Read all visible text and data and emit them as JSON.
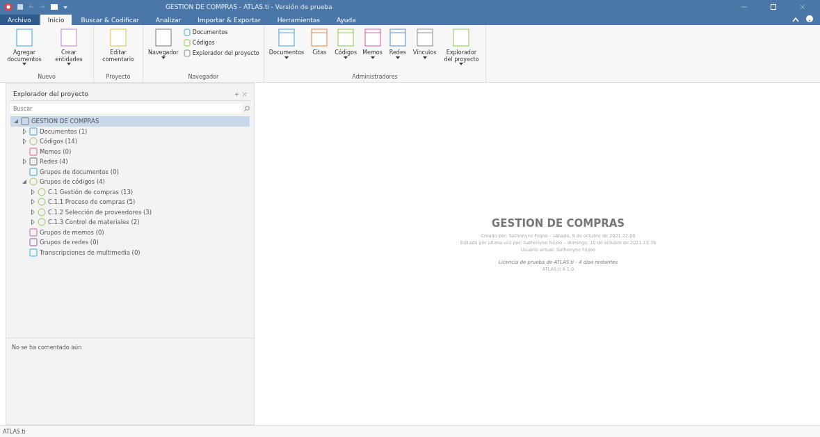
{
  "window": {
    "title": "GESTION DE COMPRAS - ATLAS.ti - Versión de prueba"
  },
  "tabs": [
    {
      "label": "Archivo",
      "selected": false,
      "kind": "file"
    },
    {
      "label": "Inicio",
      "selected": true,
      "kind": "tab"
    },
    {
      "label": "Buscar & Codificar",
      "selected": false,
      "kind": "tab"
    },
    {
      "label": "Analizar",
      "selected": false,
      "kind": "tab"
    },
    {
      "label": "Importar & Exportar",
      "selected": false,
      "kind": "tab"
    },
    {
      "label": "Herramientas",
      "selected": false,
      "kind": "tab"
    },
    {
      "label": "Ayuda",
      "selected": false,
      "kind": "tab"
    }
  ],
  "ribbon": {
    "groups": [
      {
        "label": "Nuevo",
        "buttons": [
          {
            "label": "Agregar documentos",
            "kind": "new-doc",
            "dropdown": true
          },
          {
            "label": "Crear entidades",
            "kind": "entities",
            "dropdown": true
          }
        ]
      },
      {
        "label": "Proyecto",
        "buttons": [
          {
            "label": "Editar comentario",
            "kind": "comment",
            "dropdown": false
          }
        ]
      },
      {
        "label": "Navegador",
        "buttons": [
          {
            "label": "Navegador",
            "kind": "navigator",
            "dropdown": true
          }
        ],
        "small_buttons": [
          {
            "label": "Documentos",
            "kind": "document"
          },
          {
            "label": "Códigos",
            "kind": "code"
          },
          {
            "label": "Explorador del proyecto",
            "kind": "explorer"
          }
        ]
      },
      {
        "label": "Administradores",
        "buttons": [
          {
            "label": "Documentos",
            "kind": "mgr-doc",
            "dropdown": true
          },
          {
            "label": "Citas",
            "kind": "mgr-quote",
            "dropdown": false
          },
          {
            "label": "Códigos",
            "kind": "mgr-code",
            "dropdown": true
          },
          {
            "label": "Memos",
            "kind": "mgr-memo",
            "dropdown": true
          },
          {
            "label": "Redes",
            "kind": "mgr-net",
            "dropdown": true
          },
          {
            "label": "Vínculos",
            "kind": "mgr-link",
            "dropdown": true
          },
          {
            "label": "Explorador del proyecto",
            "kind": "tree",
            "dropdown": true
          }
        ]
      }
    ]
  },
  "explorer": {
    "title": "Explorador del proyecto",
    "search": {
      "placeholder": "Buscar"
    },
    "tree": [
      {
        "label": "GESTION DE COMPRAS",
        "kind": "project",
        "expanded": true,
        "selected": true,
        "children": [
          {
            "label": "Documentos (1)",
            "kind": "document",
            "expanded": false,
            "selected": false
          },
          {
            "label": "Códigos (14)",
            "kind": "code",
            "expanded": false,
            "selected": false
          },
          {
            "label": "Memos (0)",
            "kind": "memo",
            "selected": false
          },
          {
            "label": "Redes (4)",
            "kind": "network",
            "expanded": false,
            "selected": false
          },
          {
            "label": "Grupos de documentos (0)",
            "kind": "doc-group",
            "selected": false
          },
          {
            "label": "Grupos de códigos (4)",
            "kind": "code-group",
            "expanded": true,
            "selected": false,
            "children": [
              {
                "label": "C.1 Gestión de compras (13)",
                "kind": "code-group",
                "expanded": false,
                "selected": false
              },
              {
                "label": "C.1.1 Proceso de compras (5)",
                "kind": "code-group",
                "expanded": false,
                "selected": false
              },
              {
                "label": "C.1.2 Selección de proveedores (3)",
                "kind": "code-group",
                "expanded": false,
                "selected": false
              },
              {
                "label": "C.1.3 Control de materiales (2)",
                "kind": "code-group",
                "expanded": false,
                "selected": false
              }
            ]
          },
          {
            "label": "Grupos de memos (0)",
            "kind": "memo-group",
            "selected": false
          },
          {
            "label": "Grupos de redes (0)",
            "kind": "network-group",
            "selected": false
          },
          {
            "label": "Transcripciones de multimedia (0)",
            "kind": "multimedia",
            "selected": false
          }
        ]
      }
    ],
    "comment": "No se ha comentado aún"
  },
  "project_info": {
    "title": "GESTION DE COMPRAS",
    "lines": [
      "Creado por: Sathenyne Feijoo – sábado, 9 de octubre de 2021 22:08",
      "Editado por última vez por: Sathenyne Feijoo – domingo, 10 de octubre de 2021 13:39",
      "Usuario actual: Sathenyne Feijoo"
    ],
    "license": "Licencia de prueba de ATLAS.ti - 4 días restantes",
    "version": "ATLAS.ti 9.1.0"
  },
  "status_bar": "ATLAS.ti"
}
